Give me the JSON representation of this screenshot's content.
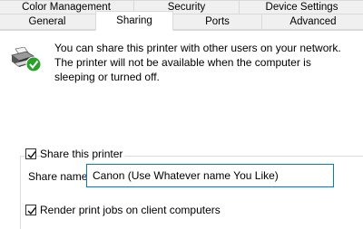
{
  "tabs": {
    "color_management": "Color Management",
    "security": "Security",
    "device_settings": "Device Settings",
    "general": "General",
    "sharing": "Sharing",
    "ports": "Ports",
    "advanced": "Advanced"
  },
  "info": {
    "line1": "You can share this printer with other users on your network.",
    "line2": "The printer will not be available when the computer is",
    "line3": "sleeping or turned off."
  },
  "share": {
    "checkbox_label": "Share this printer",
    "checked": true,
    "name_label": "Share name:",
    "name_value": "Canon (Use Whatever name You Like)"
  },
  "render": {
    "checkbox_label": "Render print jobs on client computers",
    "checked": true
  },
  "colors": {
    "accent": "#0078d7",
    "status_green": "#2aa12a"
  }
}
